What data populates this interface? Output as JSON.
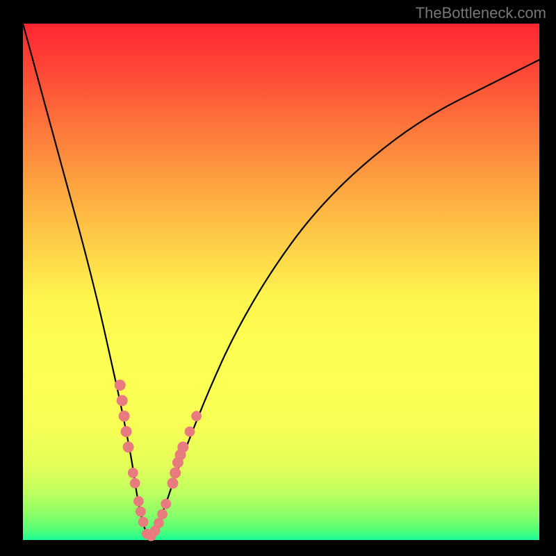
{
  "watermark": "TheBottleneck.com",
  "chart_data": {
    "type": "line",
    "title": "",
    "xlabel": "",
    "ylabel": "",
    "xlim": [
      0,
      100
    ],
    "ylim": [
      0,
      100
    ],
    "grid": false,
    "legend": false,
    "series": [
      {
        "name": "bottleneck-curve",
        "x": [
          0,
          3,
          6,
          9,
          12,
          15,
          17,
          19,
          21,
          22,
          23,
          24,
          25,
          27,
          29,
          32,
          36,
          41,
          48,
          56,
          66,
          78,
          92,
          100
        ],
        "y": [
          100,
          89,
          78,
          67,
          56,
          44,
          35,
          26,
          16,
          9,
          4,
          1,
          1,
          5,
          11,
          19,
          29,
          40,
          52,
          63,
          73,
          82,
          89,
          93
        ]
      }
    ],
    "markers": {
      "name": "highlighted-points",
      "color": "#e77b7e",
      "points": [
        {
          "x": 18.8,
          "y": 30,
          "r": 1.2
        },
        {
          "x": 19.2,
          "y": 27,
          "r": 1.2
        },
        {
          "x": 19.6,
          "y": 24,
          "r": 1.2
        },
        {
          "x": 20.0,
          "y": 21,
          "r": 1.2
        },
        {
          "x": 20.4,
          "y": 18,
          "r": 1.2
        },
        {
          "x": 21.3,
          "y": 13,
          "r": 1.1
        },
        {
          "x": 21.7,
          "y": 11,
          "r": 1.1
        },
        {
          "x": 22.4,
          "y": 7.5,
          "r": 1.1
        },
        {
          "x": 22.8,
          "y": 5.5,
          "r": 1.1
        },
        {
          "x": 23.3,
          "y": 3.5,
          "r": 1.1
        },
        {
          "x": 24.0,
          "y": 1.2,
          "r": 1.1
        },
        {
          "x": 24.8,
          "y": 0.8,
          "r": 1.1
        },
        {
          "x": 25.6,
          "y": 1.8,
          "r": 1.1
        },
        {
          "x": 26.3,
          "y": 3.3,
          "r": 1.1
        },
        {
          "x": 27.0,
          "y": 5.0,
          "r": 1.1
        },
        {
          "x": 27.7,
          "y": 7.0,
          "r": 1.1
        },
        {
          "x": 29.0,
          "y": 11,
          "r": 1.2
        },
        {
          "x": 29.5,
          "y": 13,
          "r": 1.2
        },
        {
          "x": 30.0,
          "y": 15,
          "r": 1.2
        },
        {
          "x": 30.5,
          "y": 16.5,
          "r": 1.2
        },
        {
          "x": 31.0,
          "y": 18,
          "r": 1.2
        },
        {
          "x": 32.3,
          "y": 21,
          "r": 1.1
        },
        {
          "x": 33.6,
          "y": 24,
          "r": 1.1
        }
      ]
    },
    "background_gradient": {
      "type": "vertical",
      "stops": [
        {
          "pos": 0.0,
          "color": "#fe2633"
        },
        {
          "pos": 0.5,
          "color": "#fef04d"
        },
        {
          "pos": 1.0,
          "color": "#1afd97"
        }
      ]
    }
  }
}
